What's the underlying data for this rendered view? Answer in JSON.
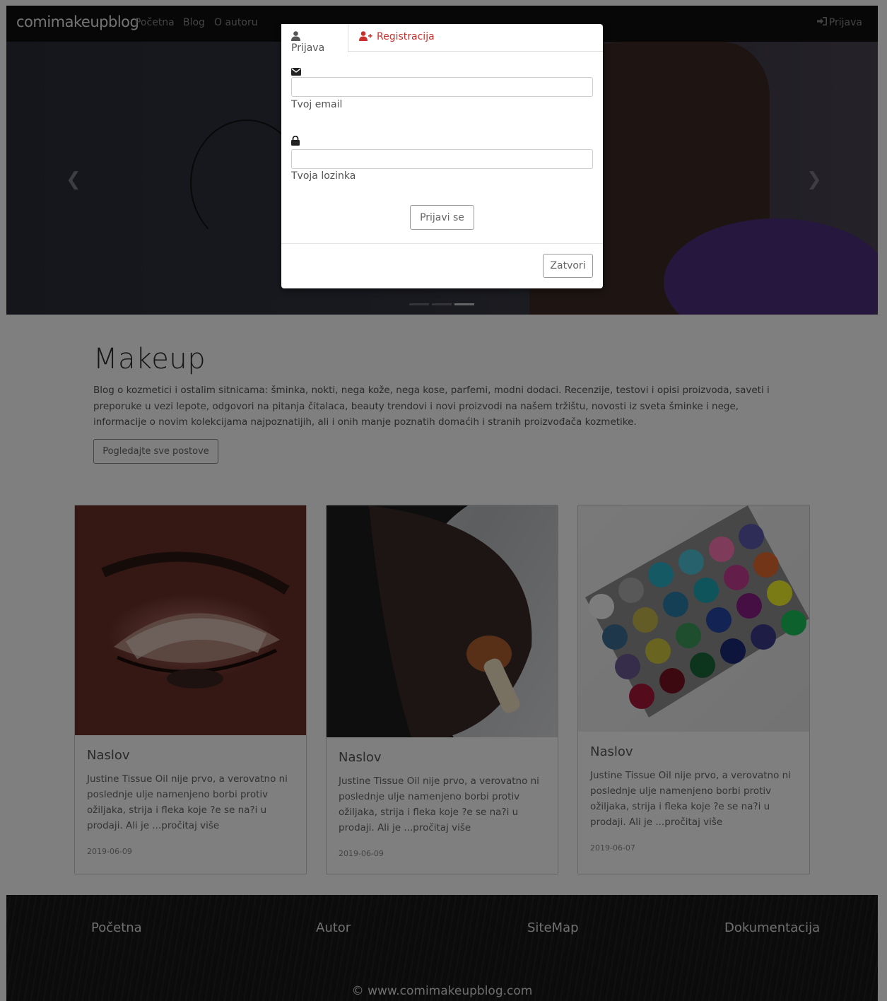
{
  "navbar": {
    "brand": "comimakeupblog",
    "links": [
      "Početna",
      "Blog",
      "O autoru"
    ],
    "login_label": "Prijava"
  },
  "intro": {
    "title": "Makeup",
    "text": "Blog o kozmetici i ostalim sitnicama: šminka, nokti, nega kože, nega kose, parfemi, modni dodaci. Recenzije, testovi i opisi proizvoda, saveti i preporuke u vezi lepote, odgovori na pitanja čitalaca, beauty trendovi i novi proizvodi na našem tržištu, novosti iz sveta šminke i nege, informacije o novim kolekcijama najpoznatijih, ali i onih manje poznatih domaćih i stranih proizvođača kozmetike.",
    "button": "Pogledajte sve postove"
  },
  "cards": [
    {
      "title": "Naslov",
      "text": "Justine Tissue Oil nije prvo, a verovatno ni poslednje ulje namenjeno borbi protiv ožiljaka, strija i fleka koje ?e se na?i u prodaji. Ali je ...pročitaj više",
      "date": "2019-06-09"
    },
    {
      "title": "Naslov",
      "text": "Justine Tissue Oil nije prvo, a verovatno ni poslednje ulje namenjeno borbi protiv ožiljaka, strija i fleka koje ?e se na?i u prodaji. Ali je ...pročitaj više",
      "date": "2019-06-09"
    },
    {
      "title": "Naslov",
      "text": "Justine Tissue Oil nije prvo, a verovatno ni poslednje ulje namenjeno borbi protiv ožiljaka, strija i fleka koje ?e se na?i u prodaji. Ali je ...pročitaj više",
      "date": "2019-06-07"
    }
  ],
  "footer": {
    "links": [
      "Početna",
      "Autor",
      "SiteMap",
      "Dokumentacija"
    ],
    "copyright": "© www.comimakeupblog.com"
  },
  "modal": {
    "tab_login": "Prijava",
    "tab_register": "Registracija",
    "email_label": "Tvoj email",
    "email_value": "",
    "password_label": "Tvoja lozinka",
    "password_value": "",
    "submit": "Prijavi se",
    "close": "Zatvori"
  },
  "icons": {
    "user": "user-icon",
    "user_plus": "user-plus-icon",
    "envelope": "envelope-icon",
    "lock": "lock-icon",
    "sign_in": "sign-in-icon",
    "prev": "chevron-left-icon",
    "next": "chevron-right-icon"
  },
  "colors": {
    "register_tab": "#c9302c",
    "navbar": "#0e0e0e",
    "backdrop": "rgba(0,0,0,0.5)"
  }
}
